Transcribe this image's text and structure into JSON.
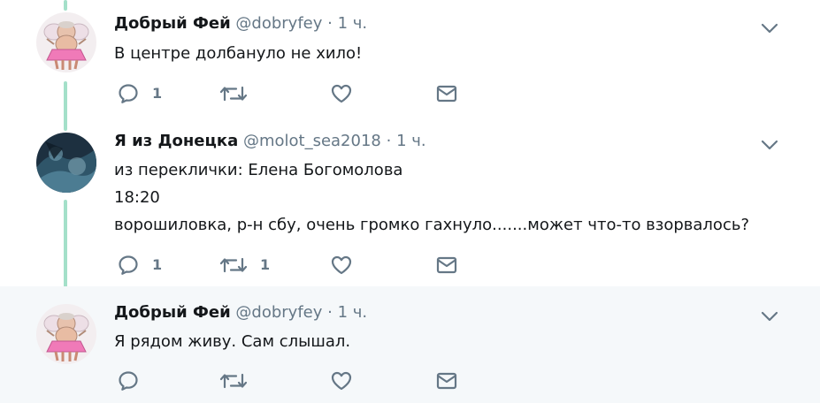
{
  "thread_line_color": "#a4e0c9",
  "tweets": [
    {
      "name": "Добрый Фей",
      "handle": "@dobryfey",
      "separator": "·",
      "time": "1 ч.",
      "lines": [
        "В центре долбануло не хило!"
      ],
      "reply_count": "1",
      "retweet_count": "",
      "avatar_icon": "fairy-avatar"
    },
    {
      "name": "Я из Донецка",
      "handle": "@molot_sea2018",
      "separator": "·",
      "time": "1 ч.",
      "lines": [
        "из переклички: Елена Богомолова",
        "18:20",
        "ворошиловка, р-н сбу, очень громко гахнуло.......может что-то взорвалось?"
      ],
      "reply_count": "1",
      "retweet_count": "1",
      "avatar_icon": "dark-photo-avatar"
    },
    {
      "name": "Добрый Фей",
      "handle": "@dobryfey",
      "separator": "·",
      "time": "1 ч.",
      "lines": [
        "Я рядом живу. Сам слышал."
      ],
      "reply_count": "",
      "retweet_count": "",
      "avatar_icon": "fairy-avatar"
    }
  ],
  "icons": {
    "reply": "reply-icon",
    "retweet": "retweet-icon",
    "like": "heart-icon",
    "message": "envelope-icon",
    "more": "chevron-down-icon"
  }
}
